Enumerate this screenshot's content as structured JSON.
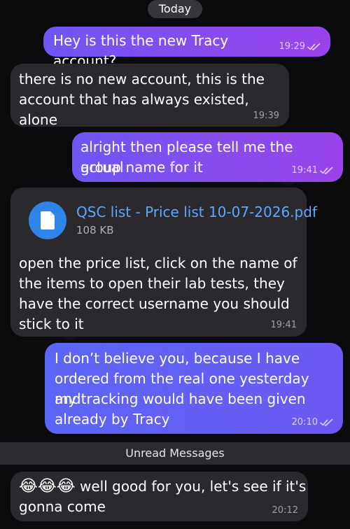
{
  "date_separator": "Today",
  "messages": [
    {
      "text": "Hey is this the new Tracy account?",
      "time": "19:29",
      "status": "read"
    },
    {
      "line1": "there is no new account, this is the",
      "line2": "account that has always existed, alone",
      "time": "19:39"
    },
    {
      "line1": "alright then please tell me the actual",
      "line2": "group name for it",
      "time": "19:41",
      "status": "read"
    },
    {
      "file_name": "QSC  list - Price list 10-07-2026.pdf",
      "file_size": "108 KB",
      "line1": "open the price list, click on the name of",
      "line2": "the items to open their lab tests, they",
      "line3": "have the correct username you should",
      "line4": "stick to it",
      "time": "19:41"
    },
    {
      "line1": "I don’t believe you, because I have",
      "line2": "ordered from the real one yesterday and",
      "line3": "my tracking would have been given",
      "line4": "already by Tracy",
      "time": "20:10",
      "status": "read"
    }
  ],
  "unread_label": "Unread Messages",
  "last_message": {
    "emoji": "😂😂😂",
    "line1": "well good for you, let's see if it's",
    "line2": "gonna come",
    "time": "20:12"
  },
  "colors": {
    "background": "#0b0a0d",
    "incoming_bubble": "#2b292d",
    "outgoing_start": "#6f56f3",
    "outgoing_end": "#9a44ea",
    "file_link": "#5fa8ff"
  },
  "icons": {
    "file": "document-icon",
    "read_status": "double-check-icon"
  }
}
